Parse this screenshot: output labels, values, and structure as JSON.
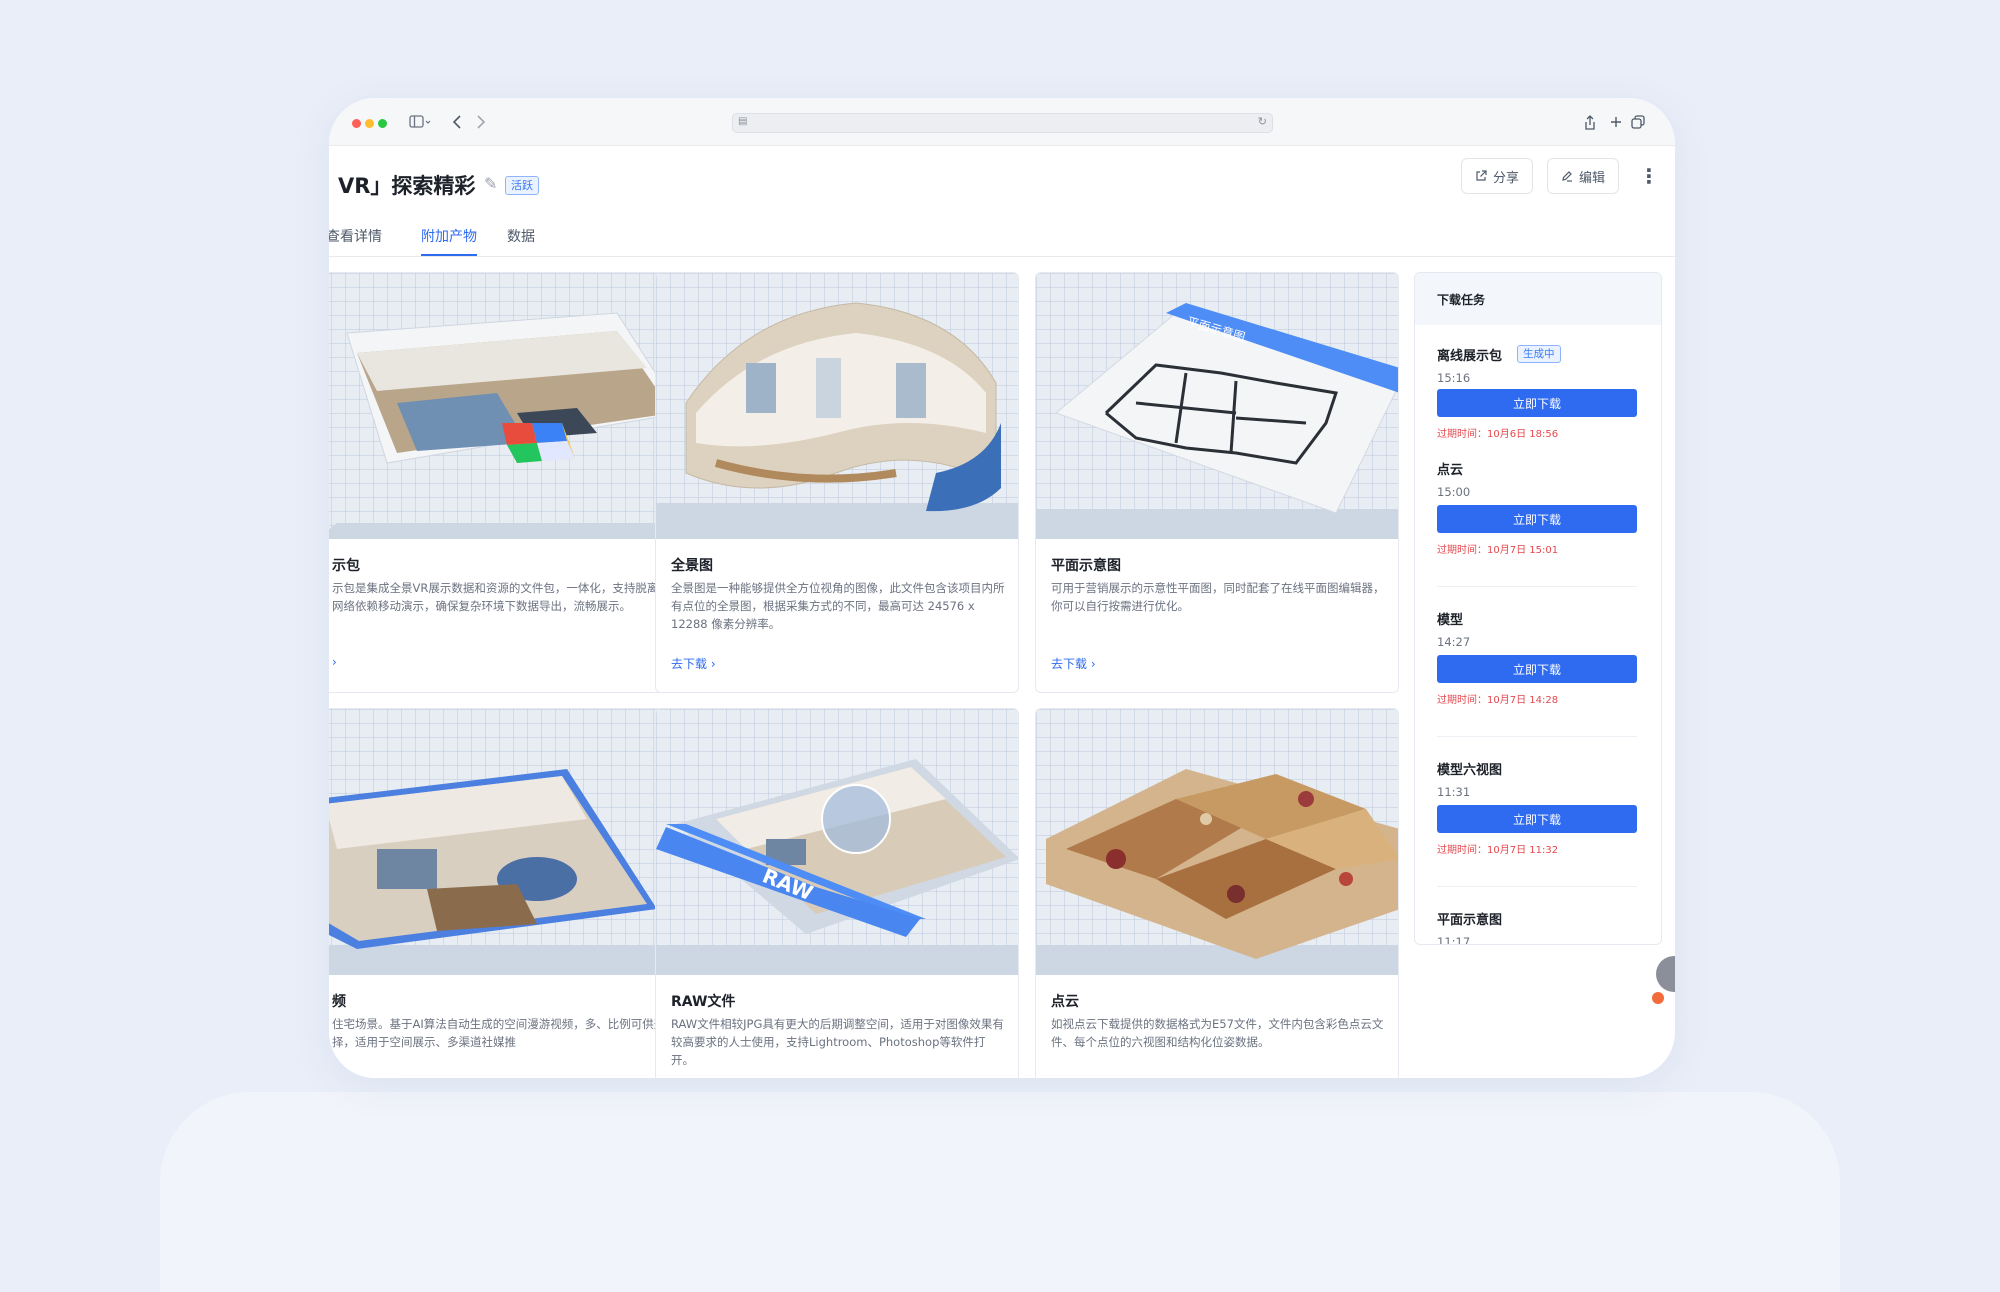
{
  "browser": {
    "traffic_lights": {
      "close": "#ff5f57",
      "minimize": "#febc2e",
      "maximize": "#28c840"
    },
    "url": ""
  },
  "header": {
    "title": "VR」探索精彩",
    "status_badge": "活跃",
    "share_label": "分享",
    "edit_label": "编辑"
  },
  "tabs": [
    {
      "label": "查看详情"
    },
    {
      "label": "附加产物",
      "active": true
    },
    {
      "label": "数据"
    }
  ],
  "cards": [
    {
      "title": "示包",
      "desc": "示包是集成全景VR展示数据和资源的文件包，一体化，支持脱离网络依赖移动演示，确保复杂环境下数据导出，流畅展示。",
      "link": "›"
    },
    {
      "title": "全景图",
      "desc": "全景图是一种能够提供全方位视角的图像，此文件包含该项目内所有点位的全景图，根据采集方式的不同，最高可达 24576 x 12288 像素分辨率。",
      "link": "去下载 ›"
    },
    {
      "title": "平面示意图",
      "desc": "可用于营销展示的示意性平面图，同时配套了在线平面图编辑器，你可以自行按需进行优化。",
      "link": "去下载 ›"
    },
    {
      "title": "频",
      "desc": "住宅场景。基于AI算法自动生成的空间漫游视频，多、比例可供选择，适用于空间展示、多渠道社媒推",
      "link": ""
    },
    {
      "title": "RAW文件",
      "desc": "RAW文件相较JPG具有更大的后期调整空间，适用于对图像效果有较高要求的人士使用，支持Lightroom、Photoshop等软件打开。",
      "link": ""
    },
    {
      "title": "点云",
      "desc": "如视点云下载提供的数据格式为E57文件，文件内包含彩色点云文件、每个点位的六视图和结构化位姿数据。",
      "link": ""
    }
  ],
  "download_panel": {
    "title": "下载任务",
    "tasks": [
      {
        "name": "离线展示包",
        "badge": "生成中",
        "time": "15:16",
        "button": "立即下载",
        "expire": "过期时间：10月6日 18:56"
      },
      {
        "name": "点云",
        "time": "15:00",
        "button": "立即下载",
        "expire": "过期时间：10月7日 15:01"
      },
      {
        "name": "模型",
        "time": "14:27",
        "button": "立即下载",
        "expire": "过期时间：10月7日 14:28"
      },
      {
        "name": "模型六视图",
        "time": "11:31",
        "button": "立即下载",
        "expire": "过期时间：10月7日 11:32"
      },
      {
        "name": "平面示意图",
        "time": "11:17"
      }
    ]
  },
  "thumb_labels": {
    "floorplan": "平面示意图",
    "raw": "RAW"
  },
  "colors": {
    "accent": "#2f6bf0",
    "expire": "#e5484d",
    "page_bg": "#e9eef8"
  }
}
